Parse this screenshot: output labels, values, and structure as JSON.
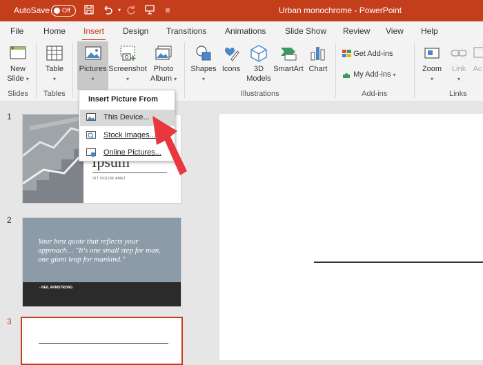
{
  "titlebar": {
    "autosave_label": "AutoSave",
    "toggle_state": "Off",
    "document_title": "Urban monochrome  -  PowerPoint"
  },
  "tabs": [
    "File",
    "Home",
    "Insert",
    "Design",
    "Transitions",
    "Animations",
    "Slide Show",
    "Review",
    "View",
    "Help"
  ],
  "active_tab": "Insert",
  "ribbon": {
    "new_slide_1": "New",
    "new_slide_2": "Slide",
    "table": "Table",
    "pictures": "Pictures",
    "screenshot": "Screenshot",
    "photo_album_1": "Photo",
    "photo_album_2": "Album",
    "shapes": "Shapes",
    "icons": "Icons",
    "models_1": "3D",
    "models_2": "Models",
    "smartart": "SmartArt",
    "chart": "Chart",
    "get_addins": "Get Add-ins",
    "my_addins": "My Add-ins",
    "zoom": "Zoom",
    "link": "Link",
    "action": "Ac",
    "groups": {
      "slides": "Slides",
      "tables": "Tables",
      "illustrations": "Illustrations",
      "addins": "Add-ins",
      "links": "Links"
    }
  },
  "dropdown": {
    "header": "Insert Picture From",
    "items": [
      "This Device...",
      "Stock Images...",
      "Online Pictures..."
    ]
  },
  "slides": {
    "numbers": [
      "1",
      "2",
      "3"
    ],
    "slide1_title": "Ipsum",
    "slide1_subtitle": "SIT DOLOR AMET",
    "slide2_quote": "Your best quote that reflects your approach… \"It's one small step for man, one giant leap for mankind.\"",
    "slide2_author": "- NEIL ARMSTRONG"
  },
  "colors": {
    "accent": "#c43e1c",
    "arrow": "#e8383d",
    "slide2_bg": "#8d9aa7"
  }
}
